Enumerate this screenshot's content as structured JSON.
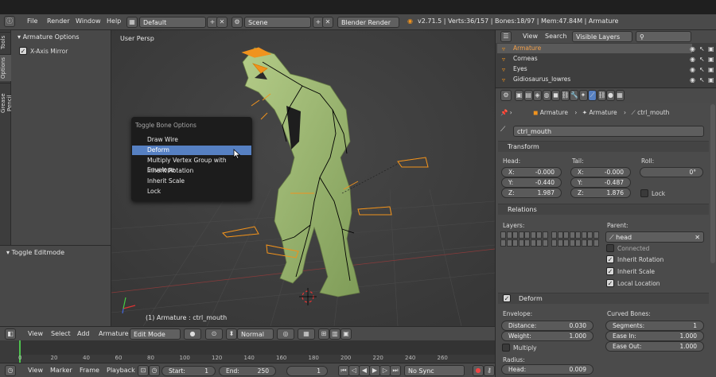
{
  "window": {
    "menu": [
      "File",
      "Render",
      "Window",
      "Help"
    ]
  },
  "topbar": {
    "screen": "Default",
    "scene": "Scene",
    "engine": "Blender Render",
    "stats": "v2.71.5 | Verts:36/157 | Bones:18/97 | Mem:47.84M | Armature"
  },
  "toolshelf": {
    "tabs": [
      "Tools",
      "Options",
      "Grease Pencil"
    ],
    "panel_title": "Armature Options",
    "xaxis_mirror": "X-Axis Mirror",
    "toggle_editmode": "Toggle Editmode"
  },
  "viewport": {
    "label": "User Persp",
    "object_label": "(1) Armature : ctrl_mouth"
  },
  "menu": {
    "title": "Toggle Bone Options",
    "items": [
      "Draw Wire",
      "Deform",
      "Multiply Vertex Group with Envelope",
      "Inherit Rotation",
      "Inherit Scale",
      "Lock"
    ],
    "active_index": 1
  },
  "header3d": {
    "items": [
      "View",
      "Select",
      "Add",
      "Armature"
    ],
    "mode": "Edit Mode",
    "pivot": "Normal"
  },
  "timeline": {
    "ticks": [
      "0",
      "20",
      "40",
      "60",
      "80",
      "100",
      "120",
      "140",
      "160",
      "180",
      "200",
      "220",
      "240",
      "260"
    ],
    "menu": [
      "View",
      "Marker",
      "Frame",
      "Playback"
    ],
    "start": "Start:",
    "start_val": "1",
    "end": "End:",
    "end_val": "250",
    "frame": "1",
    "sync": "No Sync"
  },
  "outliner": {
    "view": "View",
    "search": "Search",
    "display": "Visible Layers",
    "rows": [
      "Armature",
      "Corneas",
      "Eyes",
      "Gidiosaurus_lowres"
    ]
  },
  "props": {
    "breadcrumb": [
      "Armature",
      "Armature",
      "ctrl_mouth"
    ],
    "bone_name": "ctrl_mouth",
    "transform": {
      "title": "Transform",
      "head": "Head:",
      "tail": "Tail:",
      "roll": "Roll:",
      "hx": "-0.000",
      "hy": "-0.440",
      "hz": "1.987",
      "tx": "-0.000",
      "ty": "-0.487",
      "tz": "1.876",
      "roll_val": "0°",
      "lock": "Lock",
      "x": "X:",
      "y": "Y:",
      "z": "Z:"
    },
    "relations": {
      "title": "Relations",
      "layers": "Layers:",
      "parent": "Parent:",
      "parent_val": "head",
      "connected": "Connected",
      "inherit_rotation": "Inherit Rotation",
      "inherit_scale": "Inherit Scale",
      "local_location": "Local Location"
    },
    "deform": {
      "title": "Deform",
      "envelope": "Envelope:",
      "distance": "Distance:",
      "distance_val": "0.030",
      "weight": "Weight:",
      "weight_val": "1.000",
      "multiply": "Multiply",
      "radius": "Radius:",
      "head": "Head:",
      "head_val": "0.009",
      "curved": "Curved Bones:",
      "segments": "Segments:",
      "segments_val": "1",
      "ease_in": "Ease In:",
      "ease_in_val": "1.000",
      "ease_out": "Ease Out:",
      "ease_out_val": "1.000"
    }
  },
  "colors": {
    "accent": "#5680c2",
    "bone_orange": "#f0931e",
    "mesh_green": "#9cb870"
  }
}
